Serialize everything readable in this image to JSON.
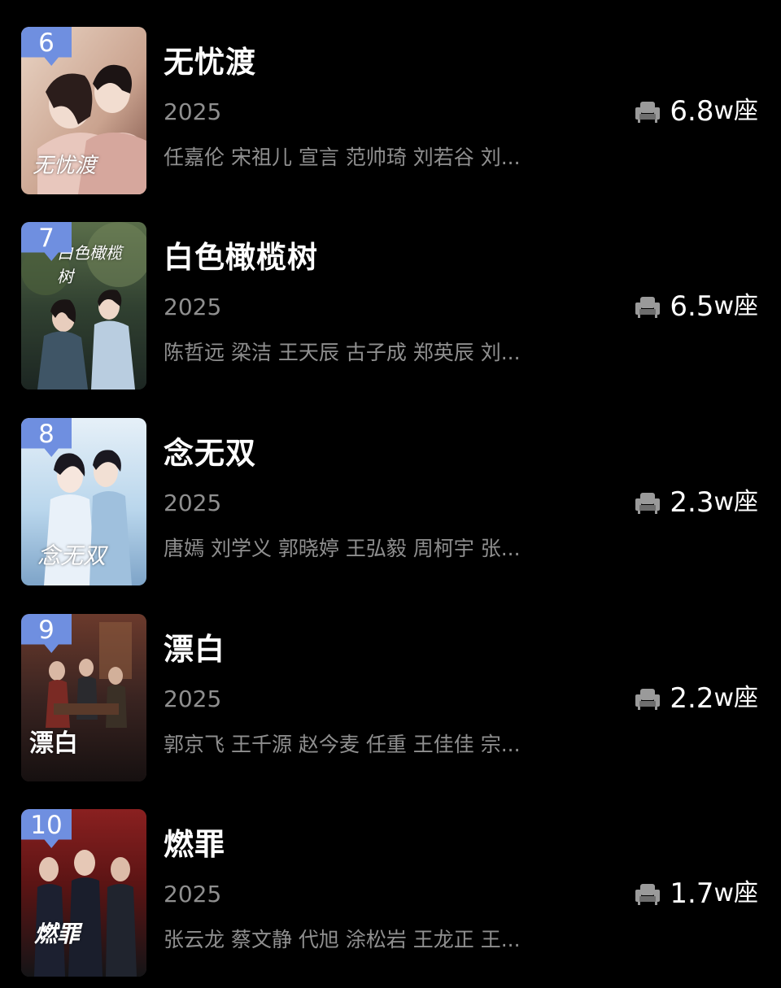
{
  "items": [
    {
      "rank": "6",
      "title": "无忧渡",
      "year": "2025",
      "cast": "任嘉伦 宋祖儿 宣言 范帅琦 刘若谷 刘...",
      "seats_value": "6.8",
      "seats_unit": "w座",
      "poster_text": "无忧渡",
      "poster_colors": [
        "#caa38f",
        "#e9d4c4",
        "#3a2626"
      ]
    },
    {
      "rank": "7",
      "title": "白色橄榄树",
      "year": "2025",
      "cast": "陈哲远 梁洁 王天辰 古子成 郑英辰 刘...",
      "seats_value": "6.5",
      "seats_unit": "w座",
      "poster_text": "白色橄榄树",
      "poster_colors": [
        "#314131",
        "#5a6e4a",
        "#1c2622"
      ]
    },
    {
      "rank": "8",
      "title": "念无双",
      "year": "2025",
      "cast": "唐嫣 刘学义 郭晓婷 王弘毅 周柯宇 张...",
      "seats_value": "2.3",
      "seats_unit": "w座",
      "poster_text": "念无双",
      "poster_colors": [
        "#b9d6ec",
        "#e6f0f8",
        "#7ea4c8"
      ]
    },
    {
      "rank": "9",
      "title": "漂白",
      "year": "2025",
      "cast": "郭京飞 王千源 赵今麦 任重 王佳佳 宗...",
      "seats_value": "2.2",
      "seats_unit": "w座",
      "poster_text": "漂白",
      "poster_colors": [
        "#3a2421",
        "#6b3a2c",
        "#161010"
      ]
    },
    {
      "rank": "10",
      "title": "燃罪",
      "year": "2025",
      "cast": "张云龙 蔡文静 代旭 涂松岩 王龙正 王...",
      "seats_value": "1.7",
      "seats_unit": "w座",
      "poster_text": "燃罪",
      "poster_colors": [
        "#5b1414",
        "#8a2020",
        "#141416"
      ]
    }
  ],
  "colors": {
    "background": "#000000",
    "badge": "#6f8fe0",
    "secondary_text": "#8f8f8f",
    "seat_icon": "#9a9a9a"
  },
  "icons": {
    "seat": "sofa-seat-icon"
  }
}
